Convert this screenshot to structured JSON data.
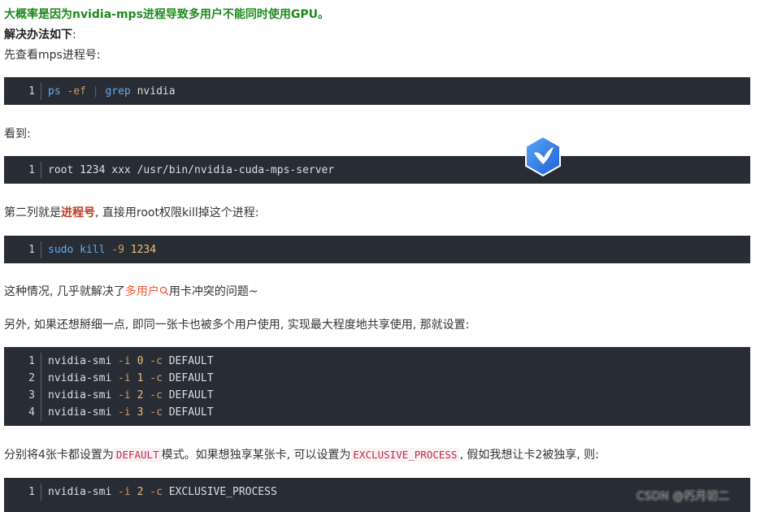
{
  "heading": "大概率是因为nvidia-mps进程导致多用户不能同时使用GPU。",
  "solution_label": "解决办法如下",
  "solution_colon": ":",
  "step1": "先查看mps进程号:",
  "code1": {
    "line": "1",
    "cmd": "ps",
    "flag": "-ef",
    "pipe": "|",
    "grep": "grep",
    "arg": "nvidia"
  },
  "see_label": "看到:",
  "code2": {
    "line": "1",
    "text": "root 1234 xxx /usr/bin/nvidia-cuda-mps-server"
  },
  "para2": {
    "before": "第二列就是",
    "strong": "进程号",
    "after": ", 直接用root权限kill掉这个进程:"
  },
  "code3": {
    "line": "1",
    "sudo": "sudo",
    "kill": "kill",
    "flag": "-9",
    "pid": "1234"
  },
  "para3": {
    "before": "这种情况, 几乎就解决了",
    "link": "多用户",
    "after": "用卡冲突的问题~"
  },
  "para4": "另外, 如果还想掰细一点, 即同一张卡也被多个用户使用, 实现最大程度地共享使用, 那就设置:",
  "code4": [
    {
      "line": "1",
      "cmd": "nvidia-smi",
      "i": "-i",
      "gpu": "0",
      "c": "-c",
      "mode": "DEFAULT"
    },
    {
      "line": "2",
      "cmd": "nvidia-smi",
      "i": "-i",
      "gpu": "1",
      "c": "-c",
      "mode": "DEFAULT"
    },
    {
      "line": "3",
      "cmd": "nvidia-smi",
      "i": "-i",
      "gpu": "2",
      "c": "-c",
      "mode": "DEFAULT"
    },
    {
      "line": "4",
      "cmd": "nvidia-smi",
      "i": "-i",
      "gpu": "3",
      "c": "-c",
      "mode": "DEFAULT"
    }
  ],
  "para5": {
    "a": "分别将4张卡都设置为",
    "code_default": "DEFAULT",
    "b": "模式。如果想独享某张卡, 可以设置为",
    "code_exclusive": "EXCLUSIVE_PROCESS",
    "c": ", 假如我想让卡2被独享, 则:"
  },
  "code5": {
    "line": "1",
    "cmd": "nvidia-smi",
    "i": "-i",
    "gpu": "2",
    "c": "-c",
    "mode": "EXCLUSIVE_PROCESS"
  },
  "watermark": "CSDN @朽月初二",
  "colors": {
    "heading": "#1e8a1e",
    "code_bg": "#282c34",
    "link": "#fc5531",
    "strong": "#c0392b"
  }
}
